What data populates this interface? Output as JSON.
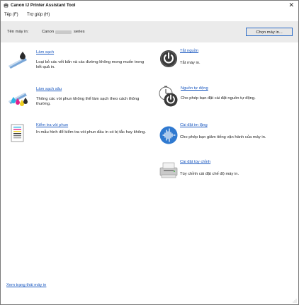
{
  "window": {
    "title": "Canon IJ Printer Assistant Tool",
    "close_glyph": "✕"
  },
  "menu": [
    {
      "label": "Tệp (F)"
    },
    {
      "label": "Trợ giúp (H)"
    }
  ],
  "printer_bar": {
    "label": "Tên máy in:",
    "printer_prefix": "Canon",
    "printer_suffix": "series",
    "select_button": "Chọn máy in..."
  },
  "left_items": [
    {
      "title": "Làm sạch",
      "desc": "Loại bỏ các vết bẩn và các đường không mong muốn trong kết quả in.",
      "icon": "cleaning-icon"
    },
    {
      "title": "Làm sạch sâu",
      "desc": "Thông các vòi phun không thể làm sạch theo cách thông thường.",
      "icon": "deep-cleaning-icon"
    },
    {
      "title": "Kiểm tra vòi phun",
      "desc": "In mẫu hình để kiểm tra vòi phun đầu in có bị tắc hay không.",
      "icon": "nozzle-check-icon"
    }
  ],
  "right_items": [
    {
      "title": "Tắt nguồn",
      "desc": "Tắt máy in.",
      "icon": "power-off-icon"
    },
    {
      "title": "Nguồn tự động",
      "desc": "Cho phép bạn đặt cài đặt nguồn tự động.",
      "icon": "auto-power-icon"
    },
    {
      "title": "Cài đặt im lặng",
      "desc": "Cho phép bạn giảm tiếng vận hành của máy in.",
      "icon": "quiet-settings-icon"
    },
    {
      "title": "Cài đặt tùy chỉnh",
      "desc": "Tùy chỉnh cài đặt chế độ máy in.",
      "icon": "custom-settings-icon"
    }
  ],
  "footer": {
    "status_link": "Xem trạng thái máy in"
  },
  "colors": {
    "link": "#1a58c0",
    "printer_bar_bg": "#ebebeb",
    "button_border": "#2b6cc8"
  }
}
